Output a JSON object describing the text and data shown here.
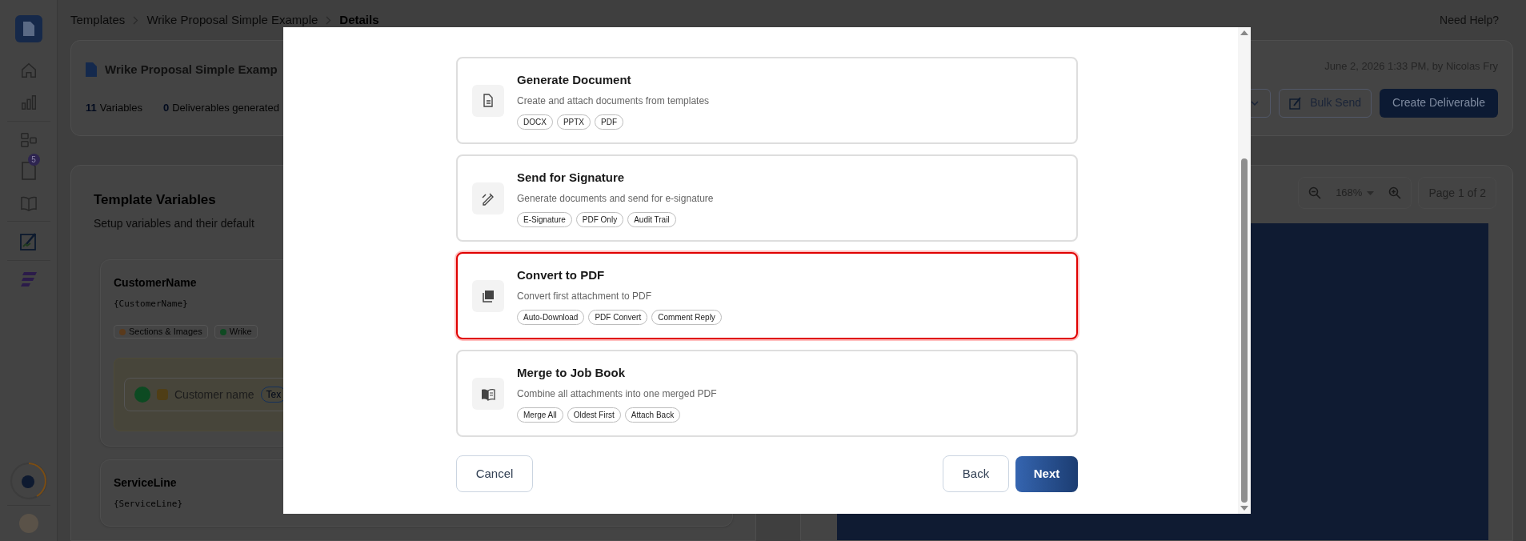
{
  "sidebar": {
    "badge": "5"
  },
  "breadcrumb": [
    "Templates",
    "Wrike Proposal Simple Example",
    "Details"
  ],
  "help_link": "Need Help?",
  "header": {
    "title": "Wrike Proposal Simple Examp",
    "stats": [
      {
        "value": "11",
        "label": "Variables"
      },
      {
        "value": "0",
        "label": "Deliverables generated"
      }
    ],
    "updated": "June 2, 2026 1:33 PM, by Nicolas Fry",
    "bulk_send": "Bulk Send",
    "create": "Create Deliverable"
  },
  "variables_panel": {
    "title": "Template Variables",
    "subtitle": "Setup variables and their default",
    "variables": [
      {
        "name": "CustomerName",
        "token": "{CustomerName}",
        "tags": [
          "Sections & Images",
          "Wrike"
        ],
        "field": {
          "label": "Customer name",
          "type": "Tex"
        }
      },
      {
        "name": "ServiceLine",
        "token": "{ServiceLine}"
      }
    ]
  },
  "preview": {
    "zoom": "168%",
    "page": "Page 1 of 2"
  },
  "dialog": {
    "actions": [
      {
        "title": "Generate Document",
        "description": "Create and attach documents from templates",
        "tags": [
          "DOCX",
          "PPTX",
          "PDF"
        ],
        "selected": false
      },
      {
        "title": "Send for Signature",
        "description": "Generate documents and send for e-signature",
        "tags": [
          "E-Signature",
          "PDF Only",
          "Audit Trail"
        ],
        "selected": false
      },
      {
        "title": "Convert to PDF",
        "description": "Convert first attachment to PDF",
        "tags": [
          "Auto-Download",
          "PDF Convert",
          "Comment Reply"
        ],
        "selected": true
      },
      {
        "title": "Merge to Job Book",
        "description": "Combine all attachments into one merged PDF",
        "tags": [
          "Merge All",
          "Oldest First",
          "Attach Back"
        ],
        "selected": false
      }
    ],
    "cancel": "Cancel",
    "back": "Back",
    "next": "Next"
  }
}
